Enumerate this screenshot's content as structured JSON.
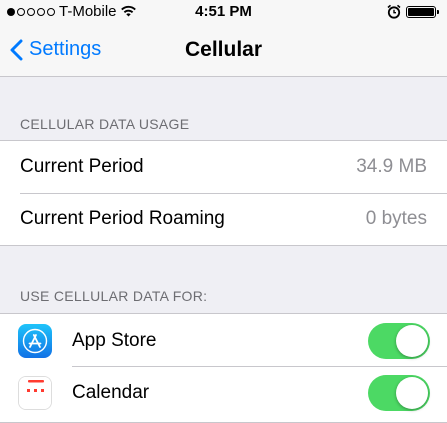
{
  "status_bar": {
    "carrier": "T-Mobile",
    "time": "4:51 PM",
    "signal_bars_filled": 1,
    "signal_bars_total": 5,
    "battery_level": 1.0
  },
  "nav": {
    "back_label": "Settings",
    "title": "Cellular"
  },
  "usage": {
    "header": "CELLULAR DATA USAGE",
    "rows": [
      {
        "label": "Current Period",
        "value": "34.9 MB"
      },
      {
        "label": "Current Period Roaming",
        "value": "0 bytes"
      }
    ]
  },
  "apps": {
    "header": "USE CELLULAR DATA FOR:",
    "items": [
      {
        "label": "App Store",
        "icon": "app-store-icon",
        "enabled": true
      },
      {
        "label": "Calendar",
        "icon": "calendar-icon",
        "enabled": true
      }
    ]
  },
  "colors": {
    "accent": "#007aff",
    "toggle_on": "#4cd964",
    "background": "#efeff4",
    "secondary_text": "#8e8e93"
  }
}
